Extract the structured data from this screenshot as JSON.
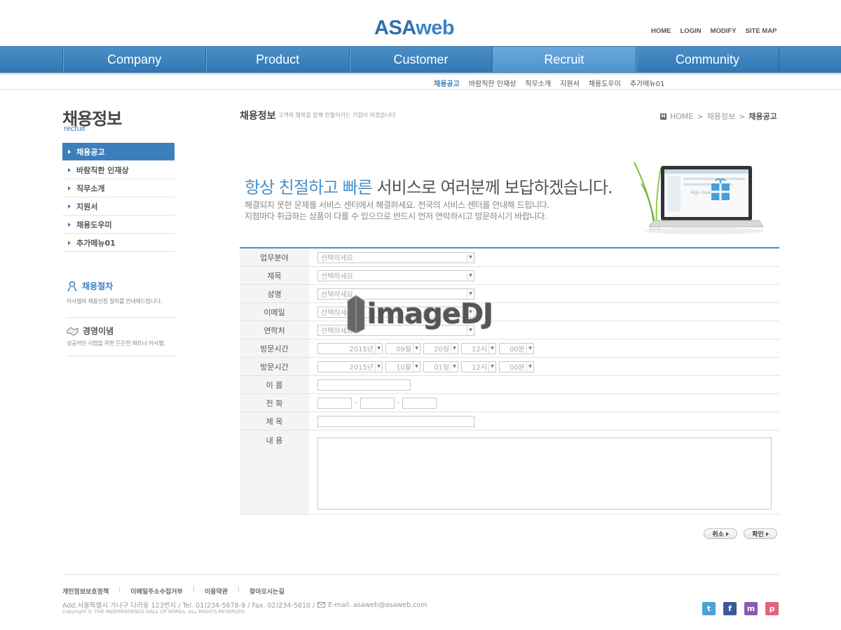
{
  "logo": {
    "part1": "ASA",
    "part2": "web"
  },
  "util_links": [
    "HOME",
    "LOGIN",
    "MODIFY",
    "SITE MAP"
  ],
  "gnb": [
    "Company",
    "Product",
    "Customer",
    "Recruit",
    "Community"
  ],
  "sub_nav": [
    "채용공고",
    "바람직한 인재상",
    "직무소개",
    "지원서",
    "채용도우미",
    "추가메뉴01"
  ],
  "lnb": {
    "title": "채용정보",
    "subtitle": "recruit",
    "items": [
      "채용공고",
      "바람직한 인재상",
      "직무소개",
      "지원서",
      "채용도우미",
      "추가메뉴01"
    ]
  },
  "side_boxes": [
    {
      "title": "채용절차",
      "desc": "아사웹의 채용신청 절차를 안내해드립니다."
    },
    {
      "title": "경영이념",
      "desc": "성공적인 사업을 위한 든든한 파트너 아사웹."
    }
  ],
  "content": {
    "title": "채용정보",
    "desc": "고객의 행복을 함께 만들어가는 기업이 되겠습니다.",
    "breadcrumb": [
      "HOME",
      "채용정보",
      "채용공고"
    ]
  },
  "banner": {
    "headline_blue": "항상 친절하고 빠른",
    "headline_rest": " 서비스로 여러분께 보답하겠습니다.",
    "line1": "해결되지 못한 문제를 서비스 센터에서 해결하세요. 전국의 서비스 센터를 안내해 드립니다.",
    "line2": "지점마다 취급하는 상품이 다를 수 있으므로 반드시 먼저 연락하시고 방문하시기 바랍니다.",
    "screen_text": "High Quality"
  },
  "form": {
    "select_placeholder": "선택하세요",
    "labels": {
      "field": "업무분야",
      "subject": "제목",
      "name": "성명",
      "email": "이메일",
      "contact": "연락처",
      "visit1": "방문시간",
      "visit2": "방문시간",
      "name2": "이 름",
      "phone": "전 화",
      "subject2": "제 목",
      "content": "내 용"
    },
    "visit1": {
      "year": "2015년",
      "month": "09월",
      "day": "20일",
      "hour": "12시",
      "minute": "00분"
    },
    "visit2": {
      "year": "2015년",
      "month": "10월",
      "day": "01일",
      "hour": "12시",
      "minute": "00분"
    }
  },
  "buttons": {
    "cancel": "취소",
    "confirm": "확인"
  },
  "watermark": "imageDJ",
  "footer": {
    "links": [
      "개인정보보호정책",
      "이메일주소수집거부",
      "이용약관",
      "찾아오시는길"
    ],
    "address": "Add.서울특별시 가나구 다라동 123번지 / Tel. 01)234-5678-9 / Fax. 02)234-5610 /",
    "email": "E-mail. asaweb@asaweb.com",
    "copyright": "Copyright © THE INDEPENDENCE HALL OF KOREA. ALL RIGHTS RESERVED."
  },
  "sns": [
    {
      "icon": "twitter-icon",
      "glyph": "t",
      "color": "#4aa3d8"
    },
    {
      "icon": "facebook-icon",
      "glyph": "f",
      "color": "#3b5a99"
    },
    {
      "icon": "messenger-icon",
      "glyph": "m",
      "color": "#8a5bb0"
    },
    {
      "icon": "pig-icon",
      "glyph": "p",
      "color": "#e3637f"
    }
  ],
  "colors": {
    "brand_blue": "#3b7fbd",
    "nav_blue": "#3277b3"
  }
}
